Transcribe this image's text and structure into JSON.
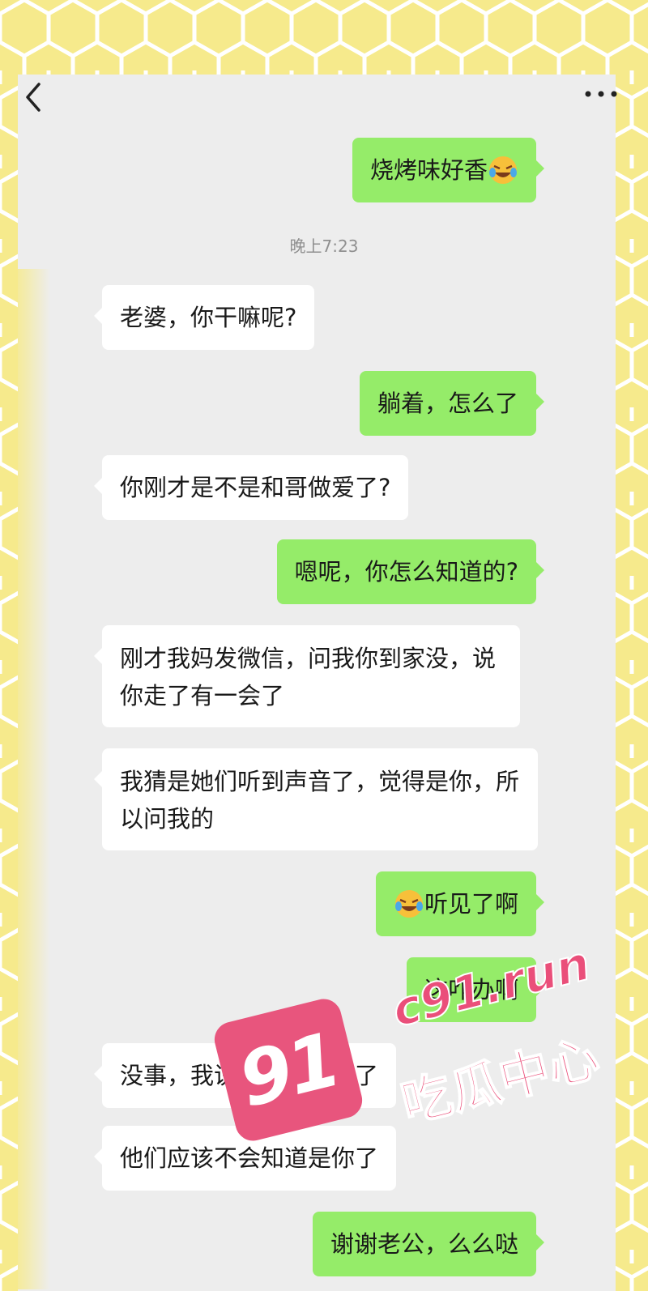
{
  "header": {
    "back_icon": "chevron-left-icon",
    "more_icon": "more-horizontal-icon"
  },
  "timestamp": "晚上7:23",
  "messages": [
    {
      "side": "out",
      "text": "烧烤味好香",
      "emoji_after": "laughing-crying-emoji"
    },
    {
      "side": "in",
      "text": "老婆，你干嘛呢?"
    },
    {
      "side": "out",
      "text": "躺着，怎么了"
    },
    {
      "side": "in",
      "text": "你刚才是不是和哥做爱了?"
    },
    {
      "side": "out",
      "text": "嗯呢，你怎么知道的?"
    },
    {
      "side": "in",
      "text": "刚才我妈发微信，问我你到家没，说你走了有一会了"
    },
    {
      "side": "in",
      "text": "我猜是她们听到声音了，觉得是你，所以问我的"
    },
    {
      "side": "out",
      "text": "听见了啊",
      "emoji_before": "laughing-crying-emoji"
    },
    {
      "side": "out",
      "text": "这咋办啊"
    },
    {
      "side": "in",
      "text": "没事，我说你已经到家了"
    },
    {
      "side": "in",
      "text": "他们应该不会知道是你了"
    },
    {
      "side": "out",
      "text": "谢谢老公，么么哒"
    }
  ],
  "watermark": {
    "number": "91",
    "url": "c91.run",
    "label": "吃瓜中心",
    "color": "#e8557d"
  },
  "colors": {
    "chat_bg": "#ededed",
    "incoming_bubble": "#ffffff",
    "outgoing_bubble": "#95ec69",
    "honeycomb": "#f6ea8c"
  }
}
